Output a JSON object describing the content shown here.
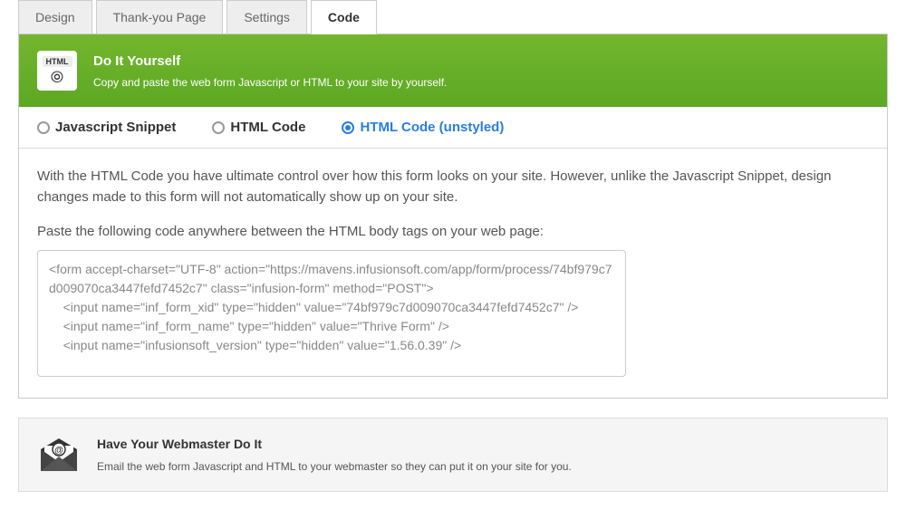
{
  "tabs": {
    "design": "Design",
    "thankyou": "Thank-you Page",
    "settings": "Settings",
    "code": "Code"
  },
  "banner": {
    "icon_label": "HTML",
    "title": "Do It Yourself",
    "subtitle": "Copy and paste the web form Javascript or HTML to your site by yourself."
  },
  "options": {
    "js": "Javascript Snippet",
    "html": "HTML Code",
    "html_unstyled": "HTML Code (unstyled)"
  },
  "description": "With the HTML Code you have ultimate control over how this form looks on your site. However, unlike the Javascript Snippet, design changes made to this form will not automatically show up on your site.",
  "paste_label": "Paste the following code anywhere between the HTML body tags on your web page:",
  "code_content": "<form accept-charset=\"UTF-8\" action=\"https://mavens.infusionsoft.com/app/form/process/74bf979c7d009070ca3447fefd7452c7\" class=\"infusion-form\" method=\"POST\">\n    <input name=\"inf_form_xid\" type=\"hidden\" value=\"74bf979c7d009070ca3447fefd7452c7\" />\n    <input name=\"inf_form_name\" type=\"hidden\" value=\"Thrive Form\" />\n    <input name=\"infusionsoft_version\" type=\"hidden\" value=\"1.56.0.39\" />",
  "webmaster": {
    "title": "Have Your Webmaster Do It",
    "subtitle": "Email the web form Javascript and HTML to your webmaster so they can put it on your site for you."
  }
}
